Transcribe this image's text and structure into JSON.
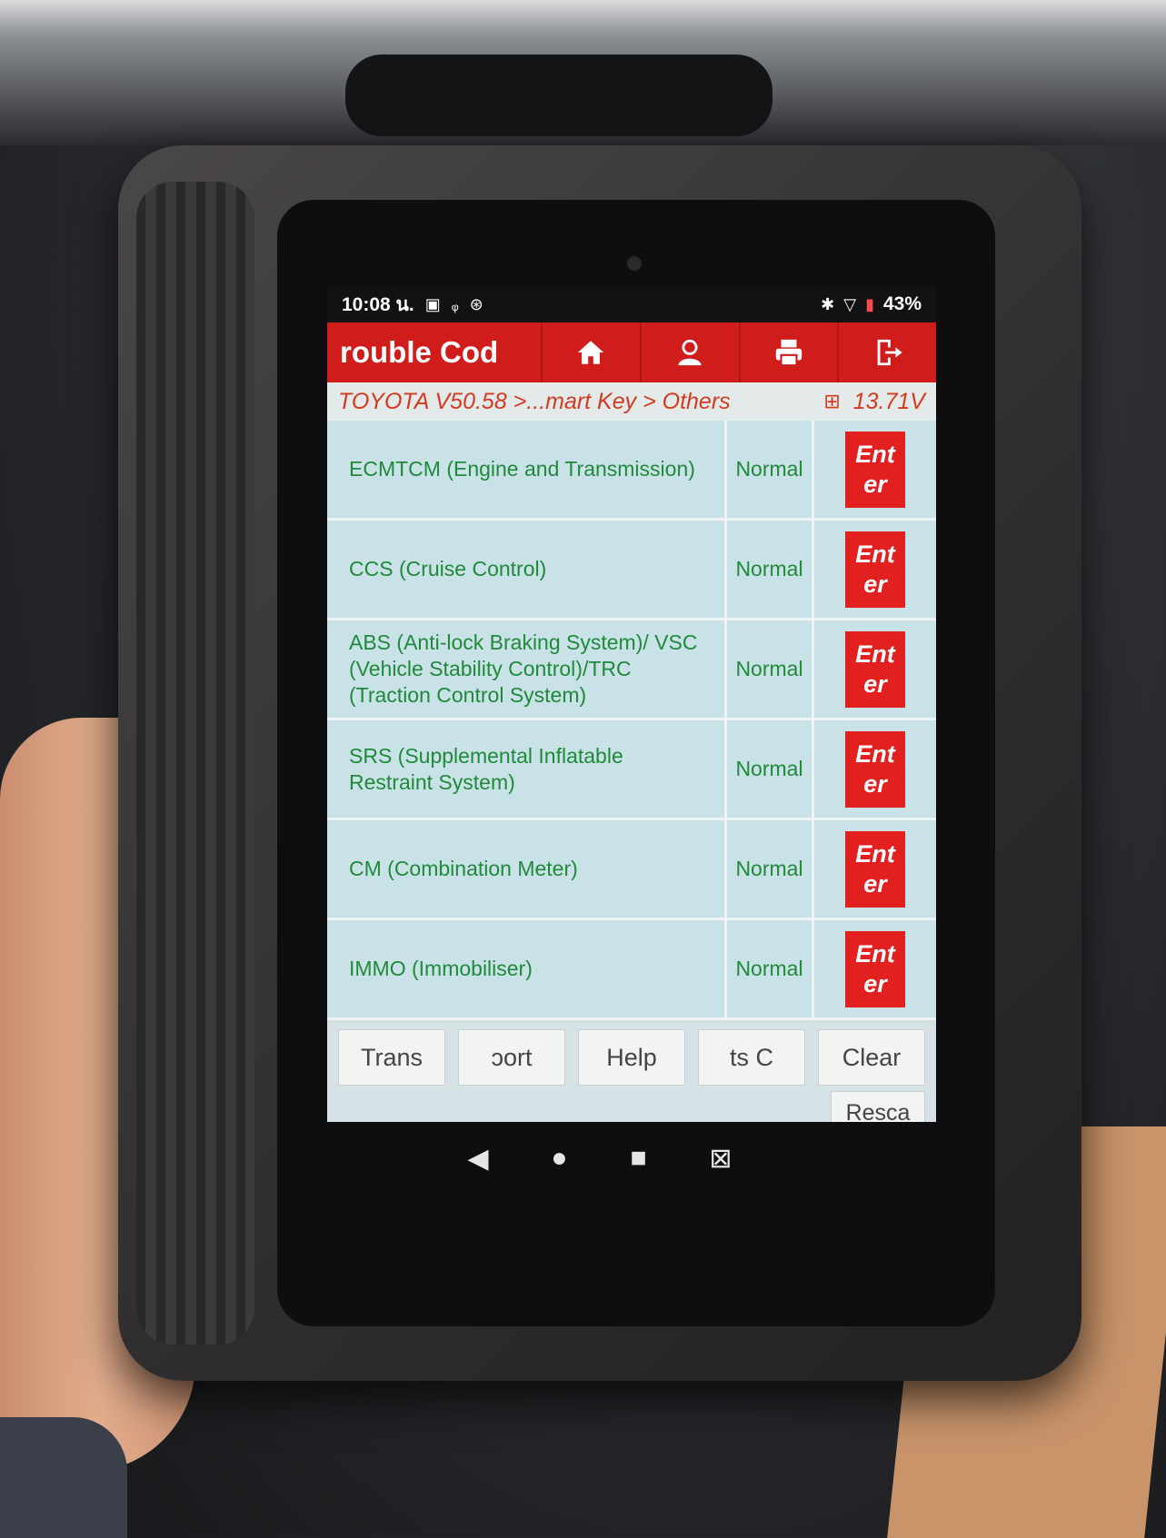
{
  "statusbar": {
    "time": "10:08 น.",
    "icons_left": [
      "calendar-icon",
      "voicemail-icon",
      "sync-icon"
    ],
    "icons_right": [
      "bluetooth-icon",
      "wifi-icon",
      "battery-icon"
    ],
    "battery": "43%"
  },
  "toolbar": {
    "title": "rouble Cod",
    "buttons": [
      "home-icon",
      "user-icon",
      "print-icon",
      "exit-icon"
    ]
  },
  "breadcrumb": {
    "path": "TOYOTA V50.58 >...mart Key > Others",
    "voltage": "13.71V"
  },
  "systems": [
    {
      "name": "ECMTCM (Engine and Transmission)",
      "status": "Normal",
      "action": "Enter"
    },
    {
      "name": "CCS (Cruise Control)",
      "status": "Normal",
      "action": "Enter"
    },
    {
      "name": "ABS (Anti-lock Braking System)/ VSC (Vehicle Stability Control)/TRC (Traction Control System)",
      "status": "Normal",
      "action": "Enter"
    },
    {
      "name": "SRS (Supplemental Inflatable Restraint System)",
      "status": "Normal",
      "action": "Enter"
    },
    {
      "name": "CM (Combination Meter)",
      "status": "Normal",
      "action": "Enter"
    },
    {
      "name": "IMMO (Immobiliser)",
      "status": "Normal",
      "action": "Enter"
    }
  ],
  "bottom_buttons": [
    "Trans",
    "ɔort",
    "Help",
    "ts C",
    "Clear"
  ],
  "rescan_button": "Resca",
  "colors": {
    "toolbar_red": "#d11c1c",
    "enter_red": "#e32020",
    "text_green": "#1f8a39",
    "breadcrumb_orange": "#d53a1f",
    "screen_bg": "#c9e2e8"
  }
}
